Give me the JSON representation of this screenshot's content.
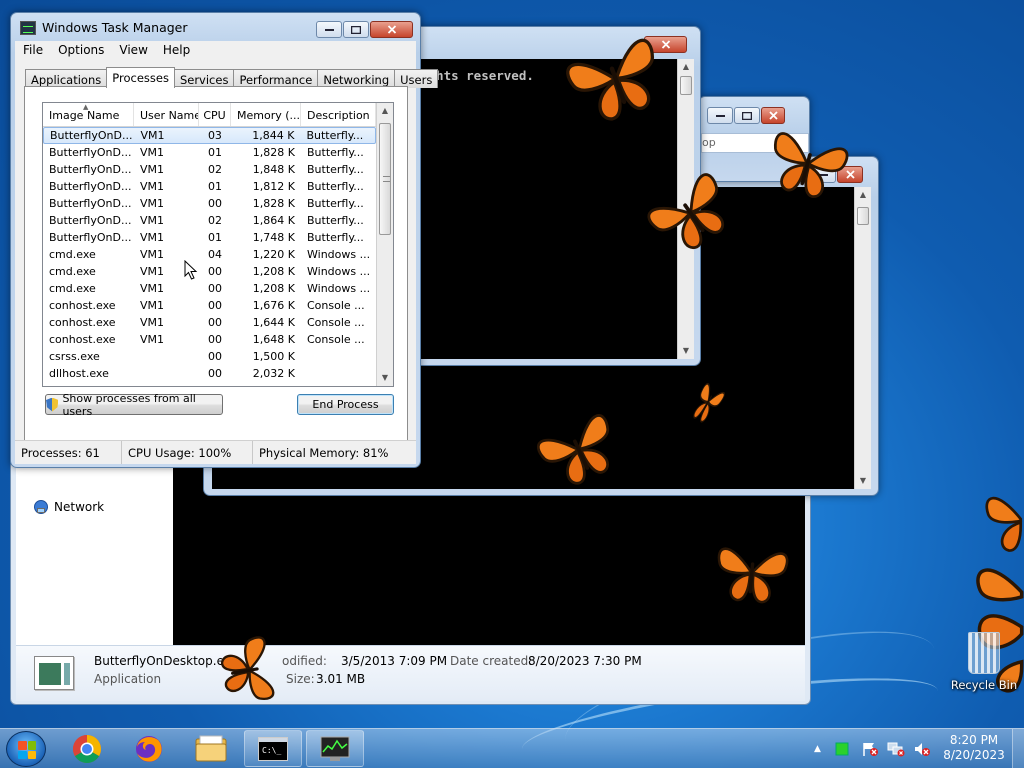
{
  "desktop": {
    "recycle_bin_label": "Recycle Bin"
  },
  "explorer": {
    "nav_network": "Network",
    "details": {
      "filename": "ButterflyOnDesktop.exe",
      "type": "Application",
      "modified_label": "odified:",
      "modified_value": "3/5/2013 7:09 PM",
      "size_label": "Size:",
      "size_value": "3.01 MB",
      "created_label": "Date created:",
      "created_value": "8/20/2023 7:30 PM"
    },
    "address_fragment": "op"
  },
  "console_a": {
    "text": "ights reserved."
  },
  "task_manager": {
    "title": "Windows Task Manager",
    "menu": [
      "File",
      "Options",
      "View",
      "Help"
    ],
    "tabs": [
      "Applications",
      "Processes",
      "Services",
      "Performance",
      "Networking",
      "Users"
    ],
    "active_tab": "Processes",
    "columns": [
      "Image Name",
      "User Name",
      "CPU",
      "Memory (...",
      "Description"
    ],
    "rows": [
      {
        "name": "ButterflyOnD...",
        "user": "VM1",
        "cpu": "03",
        "mem": "1,844 K",
        "desc": "Butterfly..."
      },
      {
        "name": "ButterflyOnD...",
        "user": "VM1",
        "cpu": "01",
        "mem": "1,828 K",
        "desc": "Butterfly..."
      },
      {
        "name": "ButterflyOnD...",
        "user": "VM1",
        "cpu": "02",
        "mem": "1,848 K",
        "desc": "Butterfly..."
      },
      {
        "name": "ButterflyOnD...",
        "user": "VM1",
        "cpu": "01",
        "mem": "1,812 K",
        "desc": "Butterfly..."
      },
      {
        "name": "ButterflyOnD...",
        "user": "VM1",
        "cpu": "00",
        "mem": "1,828 K",
        "desc": "Butterfly..."
      },
      {
        "name": "ButterflyOnD...",
        "user": "VM1",
        "cpu": "02",
        "mem": "1,864 K",
        "desc": "Butterfly..."
      },
      {
        "name": "ButterflyOnD...",
        "user": "VM1",
        "cpu": "01",
        "mem": "1,748 K",
        "desc": "Butterfly..."
      },
      {
        "name": "cmd.exe",
        "user": "VM1",
        "cpu": "04",
        "mem": "1,220 K",
        "desc": "Windows ..."
      },
      {
        "name": "cmd.exe",
        "user": "VM1",
        "cpu": "00",
        "mem": "1,208 K",
        "desc": "Windows ..."
      },
      {
        "name": "cmd.exe",
        "user": "VM1",
        "cpu": "00",
        "mem": "1,208 K",
        "desc": "Windows ..."
      },
      {
        "name": "conhost.exe",
        "user": "VM1",
        "cpu": "00",
        "mem": "1,676 K",
        "desc": "Console ..."
      },
      {
        "name": "conhost.exe",
        "user": "VM1",
        "cpu": "00",
        "mem": "1,644 K",
        "desc": "Console ..."
      },
      {
        "name": "conhost.exe",
        "user": "VM1",
        "cpu": "00",
        "mem": "1,648 K",
        "desc": "Console ..."
      },
      {
        "name": "csrss.exe",
        "user": "",
        "cpu": "00",
        "mem": "1,500 K",
        "desc": ""
      },
      {
        "name": "dllhost.exe",
        "user": "",
        "cpu": "00",
        "mem": "2,032 K",
        "desc": ""
      }
    ],
    "show_all_button": "Show processes from all users",
    "end_process_button": "End Process",
    "status": {
      "processes": "Processes: 61",
      "cpu": "CPU Usage: 100%",
      "memory": "Physical Memory: 81%"
    }
  },
  "taskbar": {
    "clock_time": "8:20 PM",
    "clock_date": "8/20/2023"
  },
  "colors": {
    "butterfly_orange": "#f07d1a",
    "desktop_blue": "#1b78cf",
    "close_red": "#c6452c"
  }
}
